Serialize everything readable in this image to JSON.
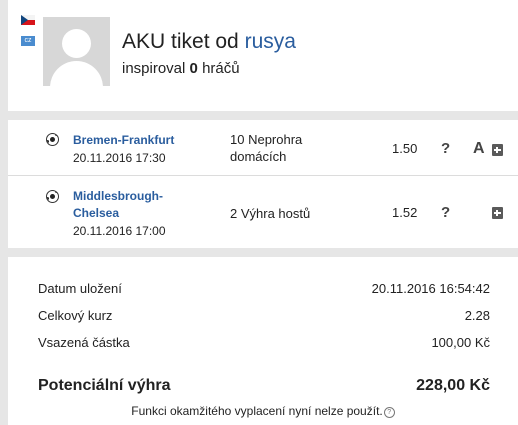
{
  "header": {
    "flag_icon": "czech-flag-icon",
    "locale_badge": "cz",
    "title_prefix": "AKU tiket od",
    "username": "rusya",
    "inspired_prefix": "inspiroval",
    "inspired_count": "0",
    "inspired_suffix": "hráčů"
  },
  "bets": [
    {
      "sport_icon": "soccer-ball-icon",
      "match": "Bremen-Frankfurt",
      "datetime": "20.11.2016 17:30",
      "tip_line1": "10 Neprohra",
      "tip_line2": "domácích",
      "odds": "1.50",
      "help": "?",
      "badge": "A"
    },
    {
      "sport_icon": "soccer-ball-icon",
      "match_line1": "Middlesbrough-",
      "match_line2": "Chelsea",
      "datetime": "20.11.2016 17:00",
      "tip": "2 Výhra hostů",
      "odds": "1.52",
      "help": "?"
    }
  ],
  "summary": {
    "saved_label": "Datum uložení",
    "saved_value": "20.11.2016 16:54:42",
    "total_odds_label": "Celkový kurz",
    "total_odds_value": "2.28",
    "stake_label": "Vsazená částka",
    "stake_value": "100,00 Kč",
    "potential_win_label": "Potenciální výhra",
    "potential_win_value": "228,00 Kč",
    "cashout_note": "Funkci okamžitého vyplacení nyní nelze použít.",
    "info_icon": "?"
  },
  "colors": {
    "link": "#2a5d9e",
    "background": "#e6e6e6",
    "panel": "#ffffff"
  }
}
